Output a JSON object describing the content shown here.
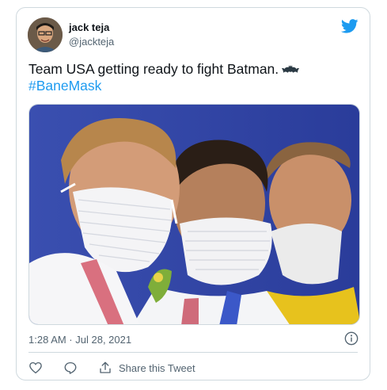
{
  "tweet": {
    "author_name": "jack teja",
    "author_handle": "@jackteja",
    "text": "Team USA getting ready to fight Batman.",
    "hashtag": "#BaneMask",
    "timestamp": "1:28 AM · Jul 28, 2021"
  },
  "actions": {
    "share_label": "Share this Tweet"
  },
  "icons": {
    "brand": "twitter-bird-icon",
    "emoji": "bat-icon",
    "info": "info-icon",
    "like": "heart-icon",
    "reply": "reply-bubble-icon",
    "share": "share-upload-icon"
  },
  "colors": {
    "link": "#1d9bf0",
    "secondary_text": "#536471",
    "border": "#cfd9de"
  }
}
